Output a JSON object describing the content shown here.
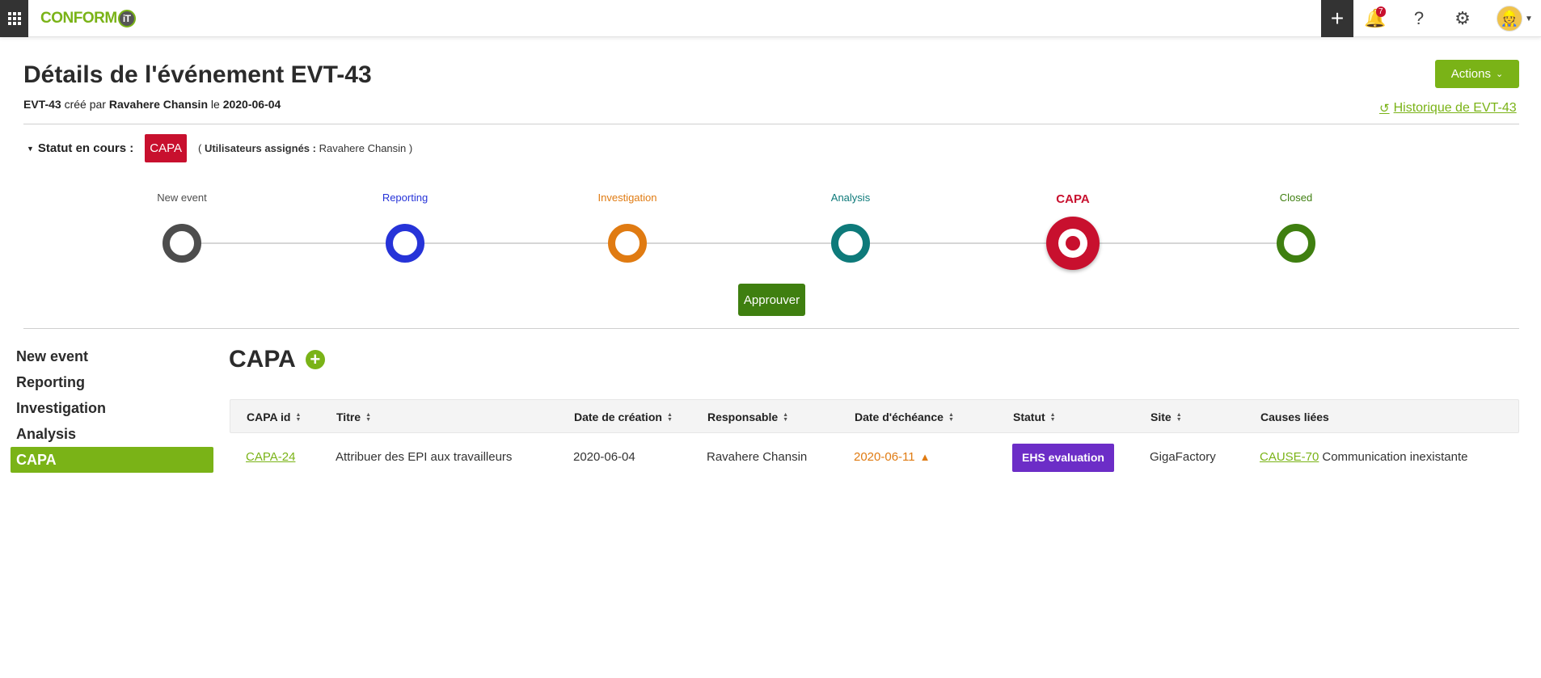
{
  "topbar": {
    "logo_text": "CONFORM",
    "logo_badge": "iT",
    "notifications_count": "7"
  },
  "header": {
    "title": "Détails de l'événement EVT-43",
    "event_id": "EVT-43",
    "created_by_text": "créé par",
    "creator": "Ravahere Chansin",
    "date_prefix": "le",
    "created_date": "2020-06-04",
    "actions_label": "Actions",
    "history_label": "Historique de EVT-43"
  },
  "status": {
    "label": "Statut en cours :",
    "current": "CAPA",
    "assigned_label": "Utilisateurs assignés :",
    "assigned_user": "Ravahere Chansin"
  },
  "workflow": {
    "steps": [
      {
        "label": "New event",
        "color": "#4d4d4d"
      },
      {
        "label": "Reporting",
        "color": "#2633d8"
      },
      {
        "label": "Investigation",
        "color": "#e07b12"
      },
      {
        "label": "Analysis",
        "color": "#0e7a7a"
      },
      {
        "label": "CAPA",
        "color": "#c8102e",
        "current": true
      },
      {
        "label": "Closed",
        "color": "#3f7f10"
      }
    ],
    "approve_label": "Approuver"
  },
  "sidenav": {
    "items": [
      "New event",
      "Reporting",
      "Investigation",
      "Analysis",
      "CAPA"
    ],
    "active": "CAPA"
  },
  "capa": {
    "title": "CAPA",
    "columns": [
      "CAPA id",
      "Titre",
      "Date de création",
      "Responsable",
      "Date d'échéance",
      "Statut",
      "Site",
      "Causes liées"
    ],
    "rows": [
      {
        "id": "CAPA-24",
        "title": "Attribuer des EPI aux travailleurs",
        "created": "2020-06-04",
        "owner": "Ravahere Chansin",
        "due": "2020-06-11",
        "status": "EHS evaluation",
        "site": "GigaFactory",
        "cause_id": "CAUSE-70",
        "cause_text": "Communication inexistante"
      }
    ]
  },
  "colors": {
    "brand_green": "#7ab317",
    "capa_red": "#c8102e",
    "status_purple": "#6c2dc7",
    "approve_green": "#3f7f10",
    "due_orange": "#e07b12"
  }
}
